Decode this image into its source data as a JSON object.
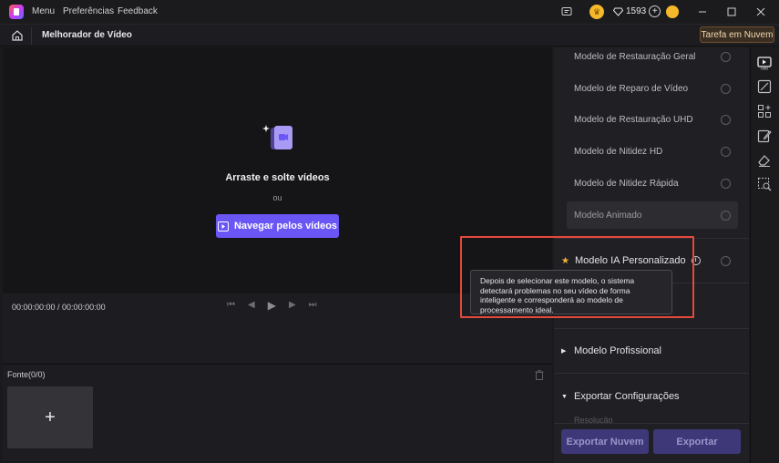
{
  "titlebar": {
    "menu": [
      "Menu",
      "Preferências",
      "Feedback"
    ],
    "credits": "1593",
    "window_controls": [
      "minimize-icon",
      "maximize-icon",
      "close-icon"
    ]
  },
  "header": {
    "title": "Melhorador de Vídeo",
    "cloud_task": "Tarefa em Nuvem"
  },
  "preview": {
    "drop_title": "Arraste e solte vídeos",
    "or_text": "ou",
    "browse_button": "Navegar pelos vídeos"
  },
  "player": {
    "timecode": "00:00:00:00 / 00:00:00:00"
  },
  "source": {
    "label": "Fonte(0/0)",
    "add_symbol": "+"
  },
  "panel": {
    "models": [
      "Modelo de Restauração Geral",
      "Modelo de Reparo de Vídeo",
      "Modelo de Restauração UHD",
      "Modelo de Nitidez HD",
      "Modelo de Nitidez Rápida",
      "Modelo Animado"
    ],
    "selected_model": "Modelo Animado",
    "custom_model": "Modelo IA Personalizado",
    "tooltip": "Depois de selecionar este modelo, o sistema detectará problemas no seu vídeo de forma inteligente e corresponderá ao modelo de processamento ideal.",
    "professional": "Modelo Profissional",
    "export_settings": "Exportar Configurações",
    "resolution_label": "Resolução",
    "export_cloud_button": "Exportar Nuvem",
    "export_button": "Exportar"
  },
  "colors": {
    "accent": "#6a55f5",
    "highlight": "#e5483c",
    "star": "#f2b43a"
  }
}
